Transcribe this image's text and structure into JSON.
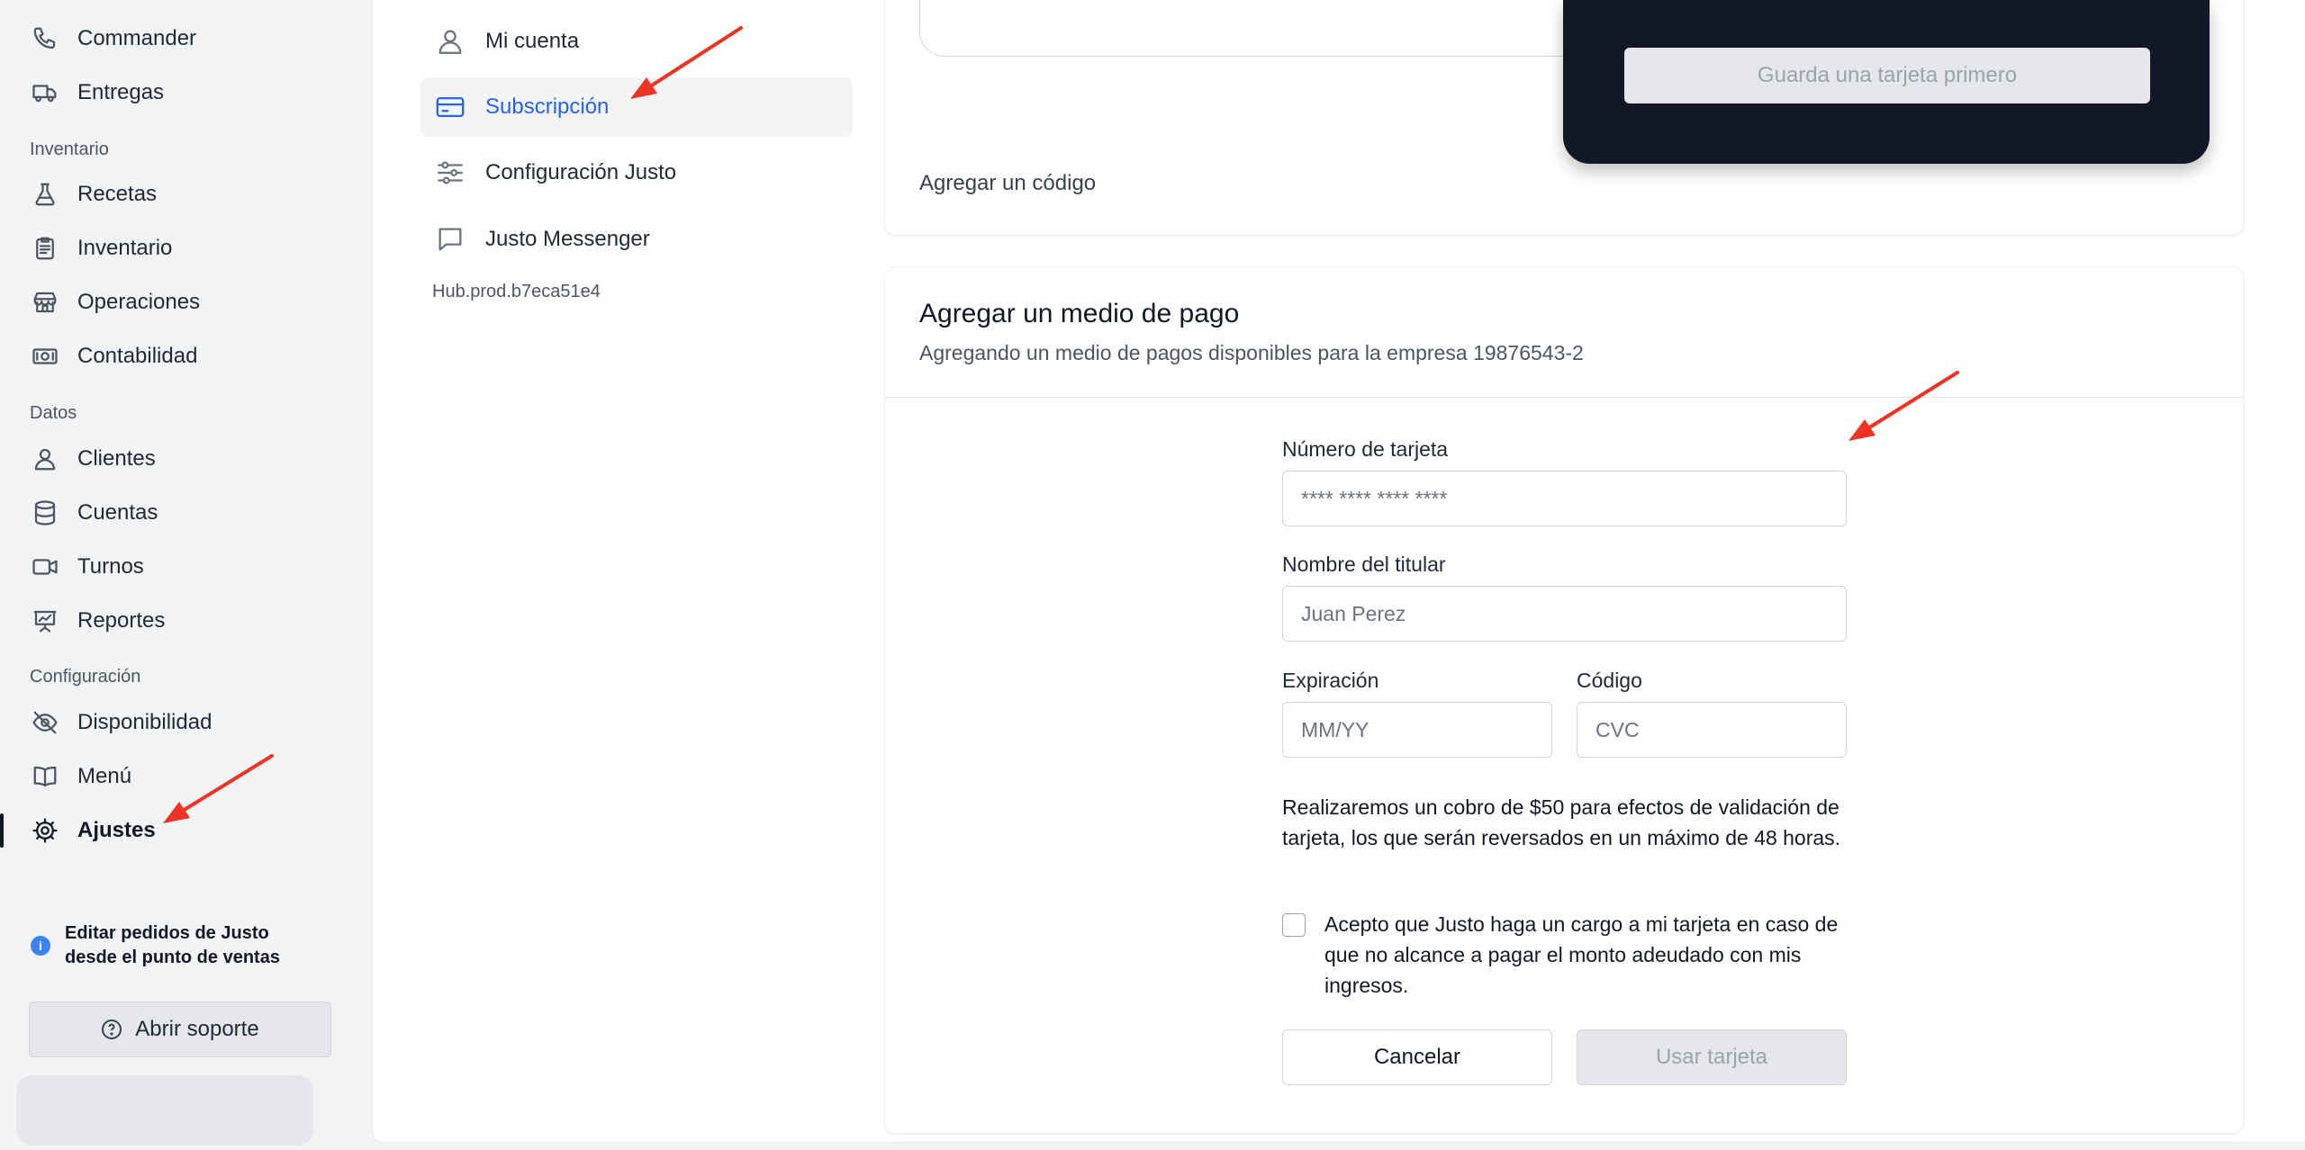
{
  "sidebar": {
    "top_items": [
      {
        "label": "Commander",
        "icon": "phone-icon"
      },
      {
        "label": "Entregas",
        "icon": "truck-icon"
      }
    ],
    "sections": [
      {
        "title": "Inventario",
        "items": [
          {
            "label": "Recetas",
            "icon": "flask-icon"
          },
          {
            "label": "Inventario",
            "icon": "clipboard-icon"
          },
          {
            "label": "Operaciones",
            "icon": "store-icon"
          },
          {
            "label": "Contabilidad",
            "icon": "cash-icon"
          }
        ]
      },
      {
        "title": "Datos",
        "items": [
          {
            "label": "Clientes",
            "icon": "user-icon"
          },
          {
            "label": "Cuentas",
            "icon": "database-icon"
          },
          {
            "label": "Turnos",
            "icon": "video-icon"
          },
          {
            "label": "Reportes",
            "icon": "presentation-chart-icon"
          }
        ]
      },
      {
        "title": "Configuración",
        "items": [
          {
            "label": "Disponibilidad",
            "icon": "eye-off-icon"
          },
          {
            "label": "Menú",
            "icon": "book-icon"
          },
          {
            "label": "Ajustes",
            "icon": "gear-icon",
            "active": true
          }
        ]
      }
    ],
    "info_note": "Editar pedidos de Justo desde el punto de ventas",
    "support_button": "Abrir soporte"
  },
  "settings_nav": {
    "items": [
      {
        "label": "Mi cuenta",
        "icon": "user-icon"
      },
      {
        "label": "Subscripción",
        "icon": "credit-card-icon",
        "active": true
      },
      {
        "label": "Configuración Justo",
        "icon": "sliders-icon"
      },
      {
        "label": "Justo Messenger",
        "icon": "chat-icon"
      }
    ],
    "hub_id": "Hub.prod.b7eca51e4"
  },
  "subscription": {
    "add_code_link": "Agregar un código",
    "save_card_first_button": "Guarda una tarjeta primero"
  },
  "payment_form": {
    "title": "Agregar un medio de pago",
    "subtitle": "Agregando un medio de pagos disponibles para la empresa 19876543-2",
    "card_number_label": "Número de tarjeta",
    "card_number_placeholder": "**** **** **** ****",
    "holder_label": "Nombre del titular",
    "holder_placeholder": "Juan Perez",
    "expiry_label": "Expiración",
    "expiry_placeholder": "MM/YY",
    "cvc_label": "Código",
    "cvc_placeholder": "CVC",
    "notice": "Realizaremos un cobro de $50 para efectos de validación de tarjeta, los que serán reversados en un máximo de 48 horas.",
    "consent_text": "Acepto que Justo haga un cargo a mi tarjeta en caso de que no alcance a pagar el monto adeudado con mis ingresos.",
    "consent_checked": false,
    "cancel_button": "Cancelar",
    "use_card_button": "Usar tarjeta"
  },
  "colors": {
    "accent_blue": "#2563eb",
    "annotation_arrow": "#ee3324",
    "dark_card": "#111827"
  }
}
